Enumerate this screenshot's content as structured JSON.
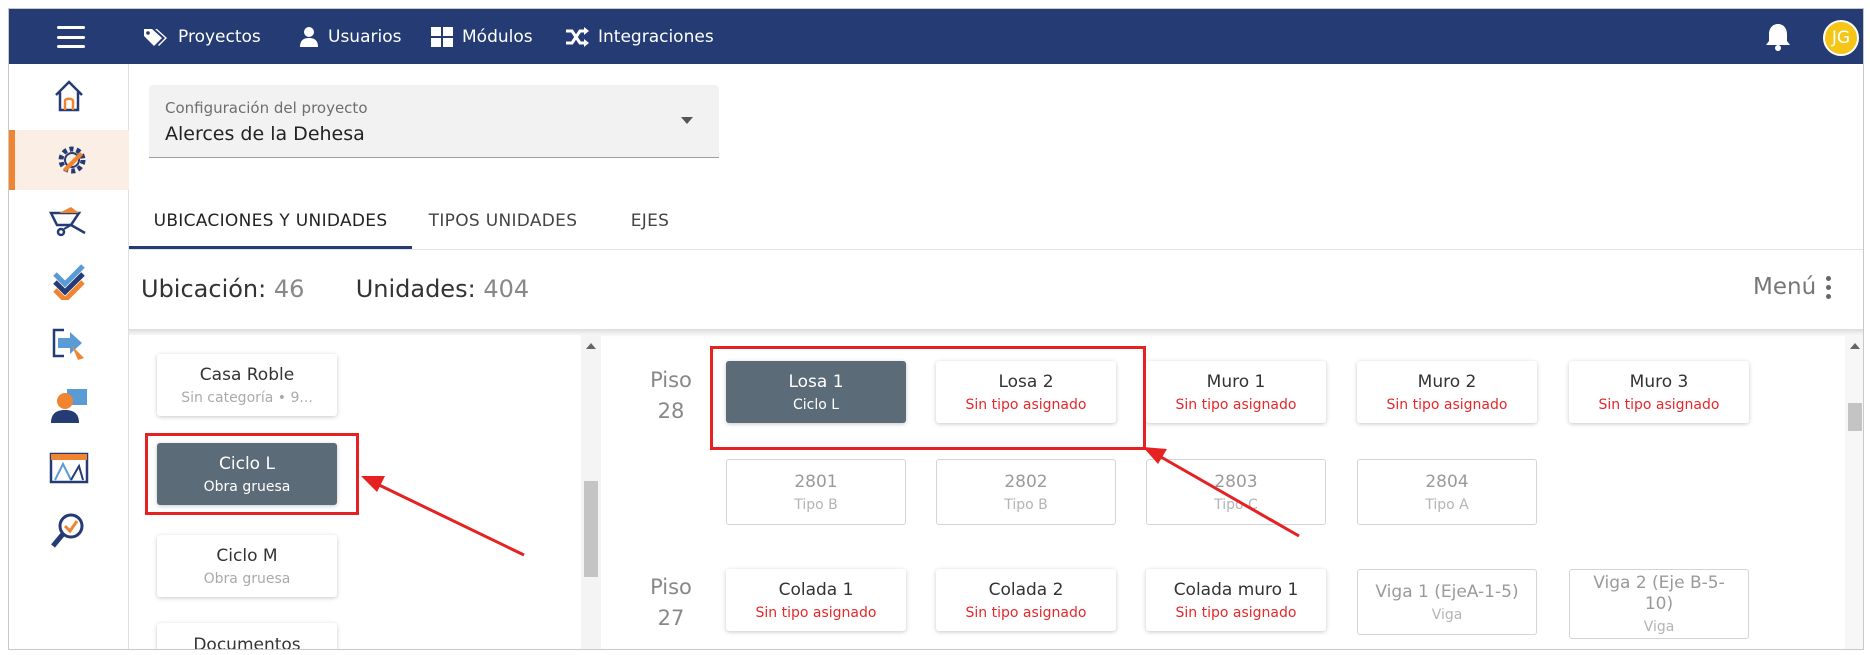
{
  "topnav": {
    "items": [
      {
        "label": "Proyectos",
        "icon": "tags-icon"
      },
      {
        "label": "Usuarios",
        "icon": "user-icon"
      },
      {
        "label": "Módulos",
        "icon": "grid-icon"
      },
      {
        "label": "Integraciones",
        "icon": "shuffle-icon"
      }
    ],
    "avatar": "JG"
  },
  "sidebar": {
    "items": [
      {
        "name": "home-icon",
        "active": false
      },
      {
        "name": "settings-pencil-icon",
        "active": true
      },
      {
        "name": "wheelbarrow-icon",
        "active": false
      },
      {
        "name": "check-stack-icon",
        "active": false
      },
      {
        "name": "login-icon",
        "active": false
      },
      {
        "name": "users-icon",
        "active": false
      },
      {
        "name": "blueprint-icon",
        "active": false
      },
      {
        "name": "inspection-icon",
        "active": false
      }
    ]
  },
  "config": {
    "label": "Configuración del proyecto",
    "value": "Alerces de la Dehesa"
  },
  "tabs": [
    {
      "label": "UBICACIONES Y UNIDADES",
      "active": true
    },
    {
      "label": "TIPOS UNIDADES",
      "active": false
    },
    {
      "label": "EJES",
      "active": false
    }
  ],
  "counts": {
    "ubicacion_label": "Ubicación:",
    "ubicacion_value": "46",
    "unidades_label": "Unidades:",
    "unidades_value": "404",
    "menu_label": "Menú"
  },
  "locations": [
    {
      "title": "Casa Roble",
      "subtitle": "Sin categoría • 9..."
    },
    {
      "title": "Ciclo L",
      "subtitle": "Obra gruesa",
      "selected": true
    },
    {
      "title": "Ciclo M",
      "subtitle": "Obra gruesa"
    },
    {
      "title": "Documentos",
      "subtitle": ""
    }
  ],
  "floors": [
    {
      "label": "Piso\n28",
      "elements": [
        {
          "title": "Losa 1",
          "subtitle": "Ciclo L",
          "selected": true
        },
        {
          "title": "Losa 2",
          "subtitle": "Sin tipo asignado"
        },
        {
          "title": "Muro 1",
          "subtitle": "Sin tipo asignado"
        },
        {
          "title": "Muro 2",
          "subtitle": "Sin tipo asignado"
        },
        {
          "title": "Muro 3",
          "subtitle": "Sin tipo asignado"
        }
      ],
      "units": [
        {
          "title": "2801",
          "subtitle": "Tipo B"
        },
        {
          "title": "2802",
          "subtitle": "Tipo B"
        },
        {
          "title": "2803",
          "subtitle": "Tipo C"
        },
        {
          "title": "2804",
          "subtitle": "Tipo A"
        }
      ]
    },
    {
      "label": "Piso\n27",
      "elements": [
        {
          "title": "Colada 1",
          "subtitle": "Sin tipo asignado"
        },
        {
          "title": "Colada 2",
          "subtitle": "Sin tipo asignado"
        },
        {
          "title": "Colada muro 1",
          "subtitle": "Sin tipo asignado"
        },
        {
          "title": "Viga 1 (EjeA-1-5)",
          "subtitle": "Viga"
        },
        {
          "title": "Viga 2 (Eje B-5-10)",
          "subtitle": "Viga"
        }
      ]
    }
  ],
  "colors": {
    "topbar": "#243b73",
    "accent": "#f08431",
    "selected_card": "#5b6b78",
    "warning_text": "#e5282a",
    "annotation": "#e62121"
  }
}
